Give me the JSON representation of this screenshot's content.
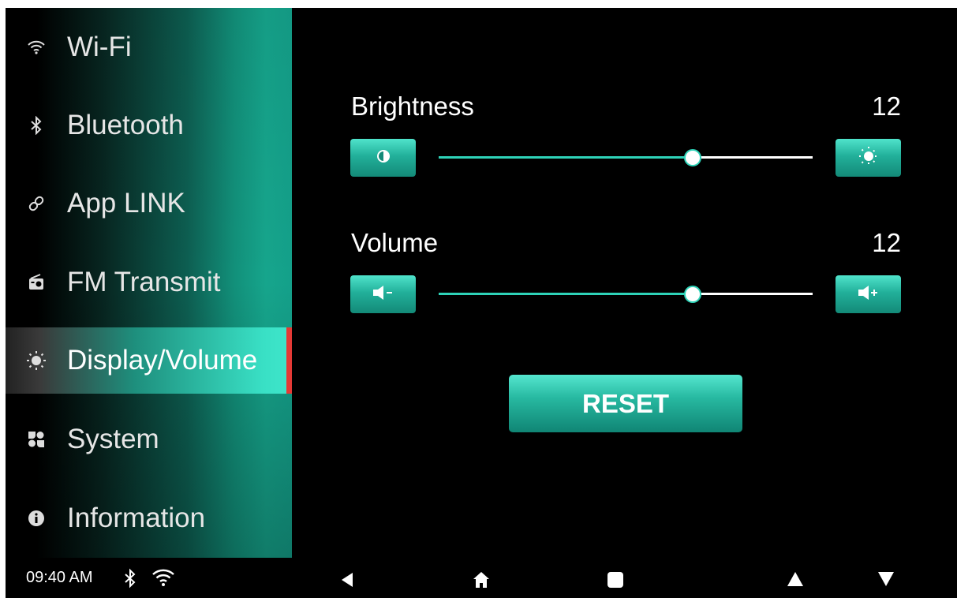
{
  "sidebar": {
    "items": [
      {
        "label": "Wi-Fi",
        "icon": "wifi-icon"
      },
      {
        "label": "Bluetooth",
        "icon": "bluetooth-icon"
      },
      {
        "label": "App LINK",
        "icon": "link-icon"
      },
      {
        "label": "FM Transmit",
        "icon": "radio-icon"
      },
      {
        "label": "Display/Volume",
        "icon": "sun-icon",
        "active": true
      },
      {
        "label": "System",
        "icon": "system-icon"
      },
      {
        "label": "Information",
        "icon": "info-icon"
      }
    ],
    "active_marker_color": "#e53935"
  },
  "brightness": {
    "label": "Brightness",
    "value": "12",
    "level": 0.68,
    "min_icon": "contrast-icon",
    "max_icon": "sun-bright-icon"
  },
  "volume": {
    "label": "Volume",
    "value": "12",
    "level": 0.68,
    "min_icon": "volume-down-icon",
    "max_icon": "volume-up-icon"
  },
  "reset_label": "RESET",
  "statusbar": {
    "time": "09:40 AM",
    "icons": [
      "bluetooth-icon",
      "wifi-icon"
    ],
    "nav": [
      "back-icon",
      "home-icon",
      "recents-icon",
      "up-icon",
      "down-icon"
    ]
  },
  "colors": {
    "accent": "#2ed3b8",
    "background": "#000000"
  }
}
